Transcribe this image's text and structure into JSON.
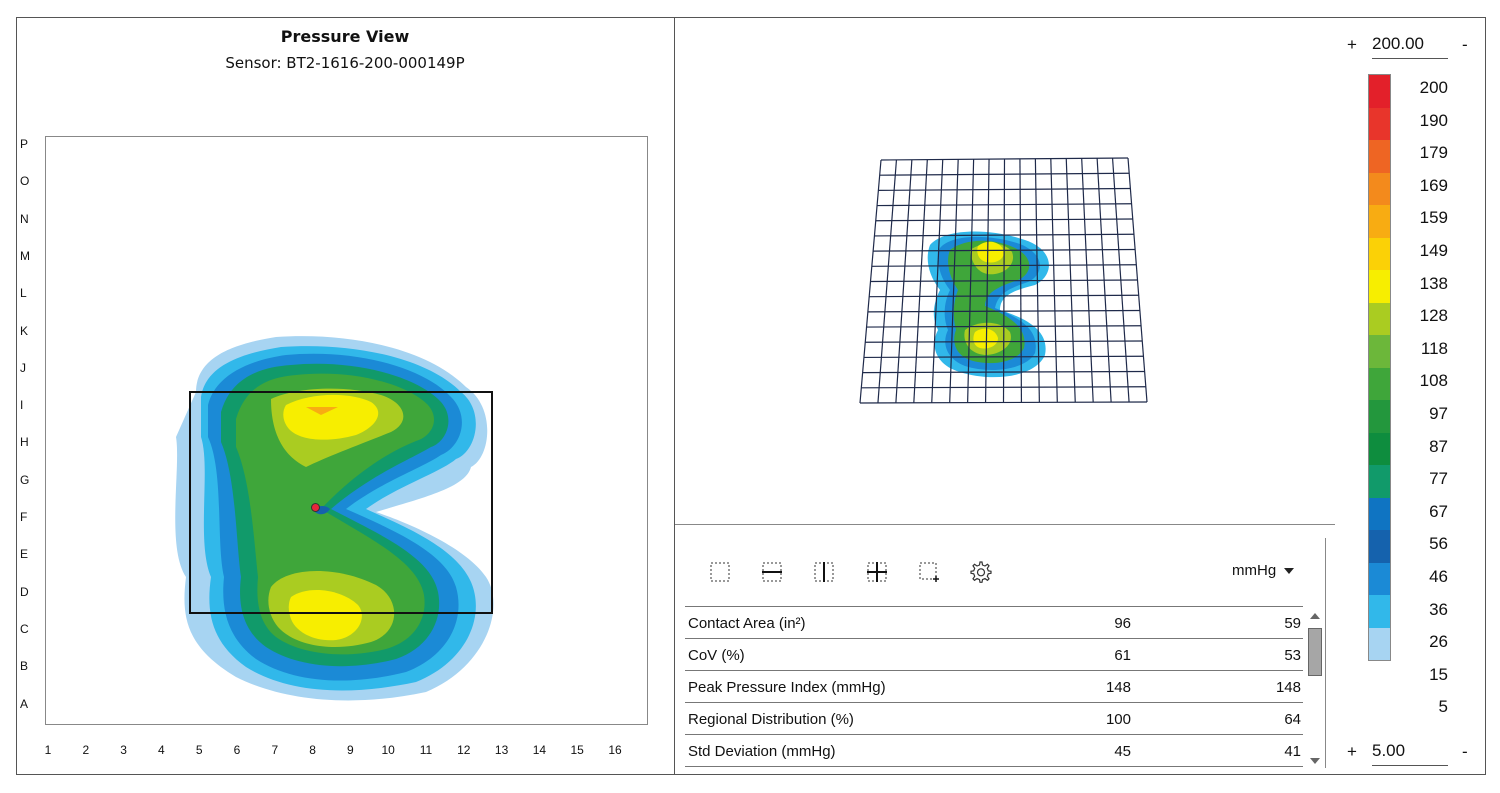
{
  "left_panel": {
    "title": "Pressure View",
    "subtitle": "Sensor: BT2-1616-200-000149P",
    "row_labels": [
      "P",
      "O",
      "N",
      "M",
      "L",
      "K",
      "J",
      "I",
      "H",
      "G",
      "F",
      "E",
      "D",
      "C",
      "B",
      "A"
    ],
    "col_labels": [
      "1",
      "2",
      "3",
      "4",
      "5",
      "6",
      "7",
      "8",
      "9",
      "10",
      "11",
      "12",
      "13",
      "14",
      "15",
      "16"
    ]
  },
  "toolbar": {
    "icons": [
      "select-region-icon",
      "horizontal-split-icon",
      "vertical-split-icon",
      "quad-split-icon",
      "add-region-icon",
      "gear-icon"
    ],
    "unit": "mmHg"
  },
  "stats": [
    {
      "name": "Contact Area (in²)",
      "v1": "96",
      "v2": "59"
    },
    {
      "name": "CoV (%)",
      "v1": "61",
      "v2": "53"
    },
    {
      "name": "Peak Pressure Index (mmHg)",
      "v1": "148",
      "v2": "148"
    },
    {
      "name": "Regional Distribution (%)",
      "v1": "100",
      "v2": "64"
    },
    {
      "name": "Std Deviation (mmHg)",
      "v1": "45",
      "v2": "41"
    }
  ],
  "legend": {
    "max_value": "200.00",
    "min_value": "5.00",
    "plus": "+",
    "minus": "-",
    "labels": [
      "200",
      "190",
      "179",
      "169",
      "159",
      "149",
      "138",
      "128",
      "118",
      "108",
      "97",
      "87",
      "77",
      "67",
      "56",
      "46",
      "36",
      "26",
      "15",
      "5"
    ],
    "colors": [
      "#e3202a",
      "#e8352b",
      "#ee6523",
      "#f38a1c",
      "#f8ac12",
      "#fbd106",
      "#f7ee00",
      "#aacc21",
      "#6cb73a",
      "#3fa63a",
      "#23973d",
      "#0e8d3e",
      "#119a6a",
      "#0f74c2",
      "#1562ad",
      "#1b8ad6",
      "#31b8ea",
      "#a7d4f2"
    ]
  }
}
